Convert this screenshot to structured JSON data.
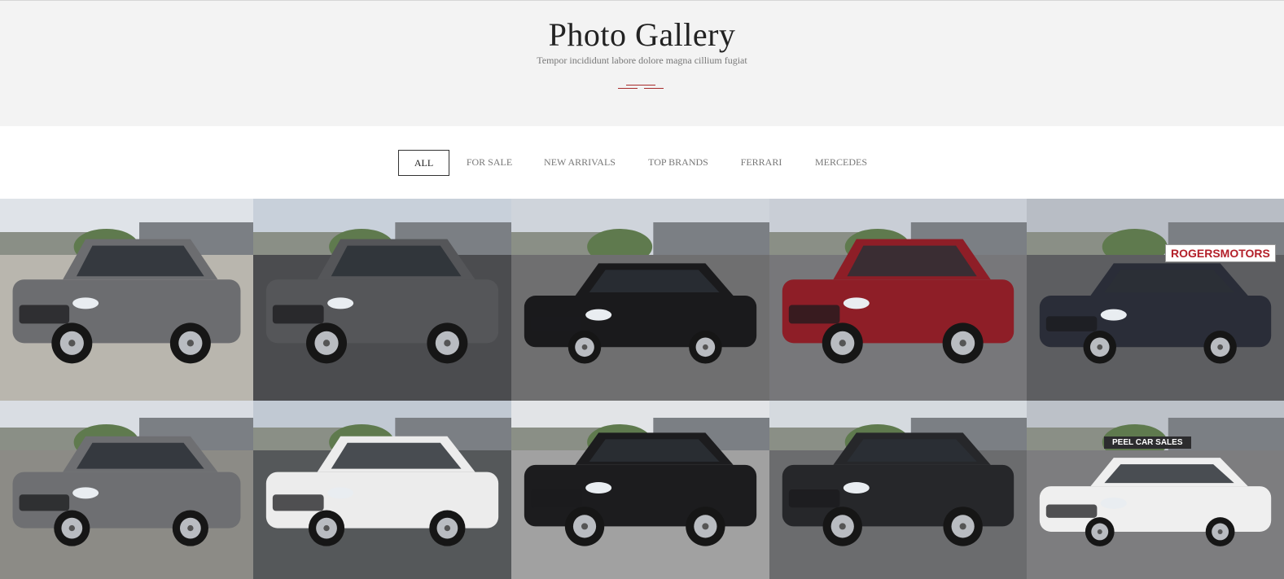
{
  "hero": {
    "title": "Photo Gallery",
    "subtitle": "Tempor incididunt labore dolore magna cillium fugiat"
  },
  "filters": [
    {
      "label": "ALL",
      "active": true
    },
    {
      "label": "FOR SALE",
      "active": false
    },
    {
      "label": "NEW ARRIVALS",
      "active": false
    },
    {
      "label": "TOP BRANDS",
      "active": false
    },
    {
      "label": "FERRARI",
      "active": false
    },
    {
      "label": "MERCEDES",
      "active": false
    }
  ],
  "gallery": [
    {
      "subject": "grey minivan",
      "body": "van",
      "color": "#6c6d70"
    },
    {
      "subject": "grey compact SUV",
      "body": "suv",
      "color": "#555659"
    },
    {
      "subject": "black coupe",
      "body": "sedan",
      "color": "#1a1a1c"
    },
    {
      "subject": "red SUV",
      "body": "suv",
      "color": "#8e1e27"
    },
    {
      "subject": "dark sedan at Rogers Motors",
      "body": "sedan",
      "color": "#2a2d38"
    },
    {
      "subject": "silver Mercedes SUV",
      "body": "suv",
      "color": "#6e6f72"
    },
    {
      "subject": "white Range Rover",
      "body": "suv",
      "color": "#ececec"
    },
    {
      "subject": "black pickup truck",
      "body": "truck",
      "color": "#1c1c1e"
    },
    {
      "subject": "black pickup truck",
      "body": "truck",
      "color": "#26272a"
    },
    {
      "subject": "white sedan at Peel Car Sales",
      "body": "sedan",
      "color": "#efefef"
    }
  ],
  "signs": {
    "rogers": "ROGERSMOTORS",
    "peel": "PEEL CAR SALES"
  }
}
